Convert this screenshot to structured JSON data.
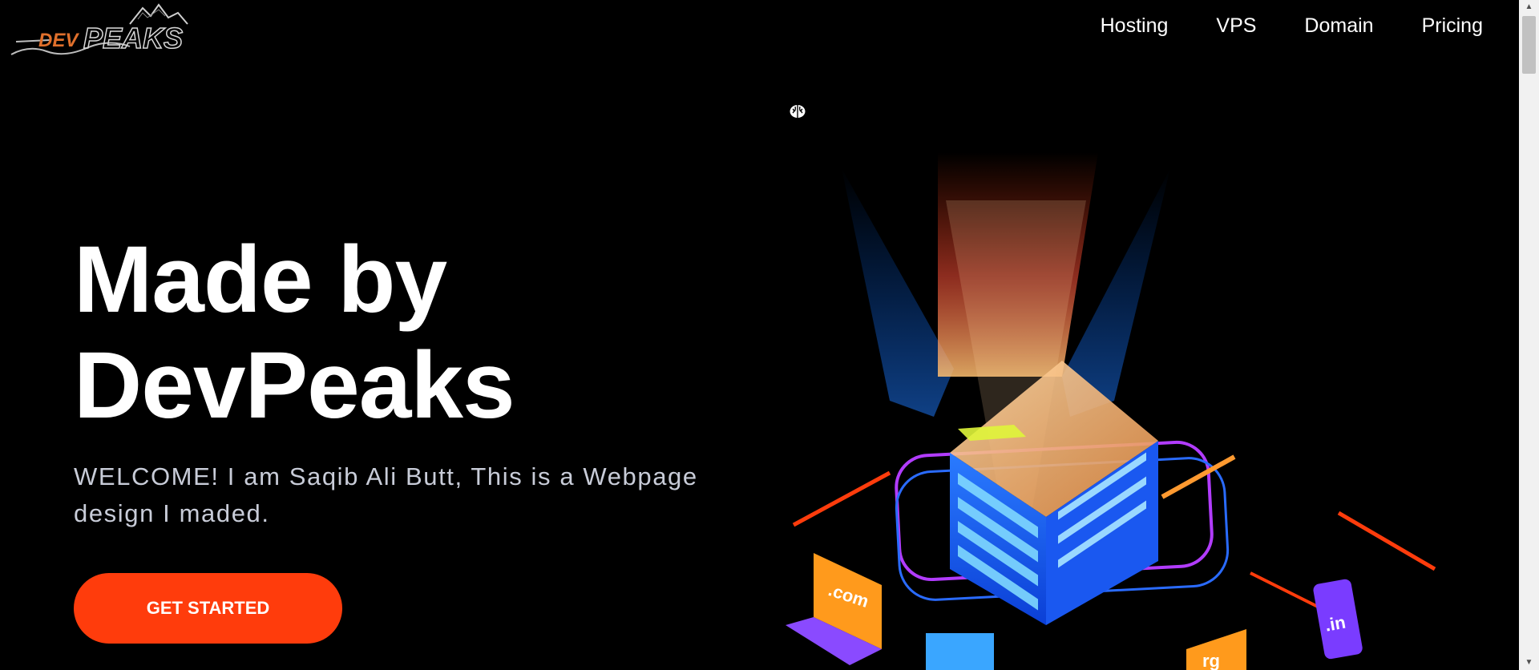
{
  "logo": {
    "part1": "DEV",
    "part2": "PEAKS"
  },
  "nav": {
    "items": [
      {
        "label": "Hosting"
      },
      {
        "label": "VPS"
      },
      {
        "label": "Domain"
      },
      {
        "label": "Pricing"
      }
    ]
  },
  "hero": {
    "title_line1": "Made by",
    "title_line2": "DevPeaks",
    "subtitle": "WELCOME! I am Saqib Ali Butt, This is a Webpage design I maded.",
    "cta_label": "GET STARTED"
  },
  "illustration": {
    "tld_com": ".com",
    "tld_in": ".in",
    "tld_org_partial": "rg"
  },
  "colors": {
    "background": "#000000",
    "accent": "#ff3c0c",
    "text": "#ffffff",
    "subtitle": "#c8ccd8",
    "server_blue": "#1565ff",
    "neon_purple": "#b23cff"
  },
  "icons": {
    "cursor_icon": "brain-icon"
  }
}
